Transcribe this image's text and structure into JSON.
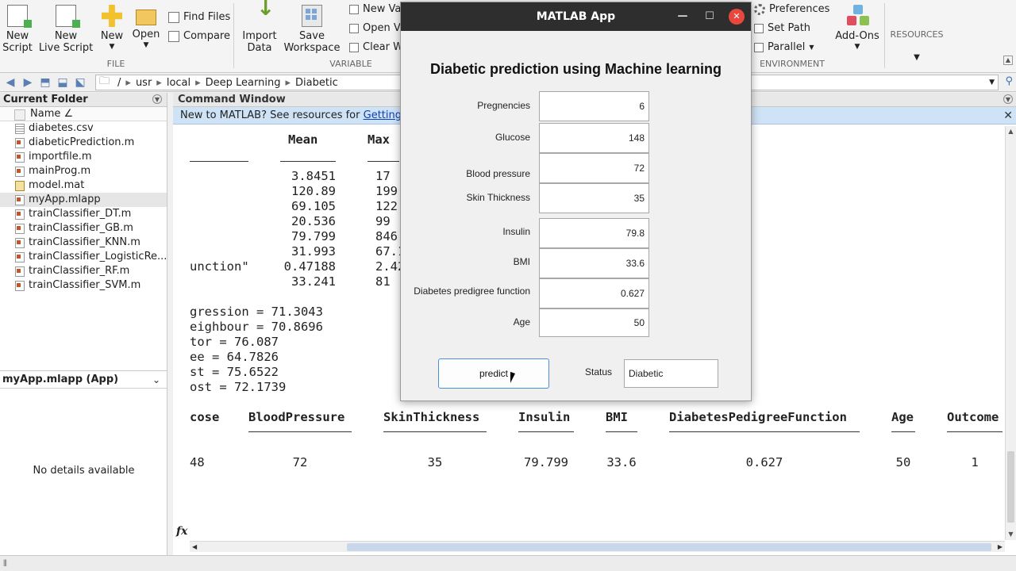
{
  "toolstrip": {
    "file": {
      "new_script": "New\nScript",
      "new_live_script": "New\nLive Script",
      "new": "New",
      "open": "Open",
      "find_files": "Find Files",
      "compare": "Compare",
      "label": "FILE"
    },
    "variable": {
      "import_data": "Import\nData",
      "save_workspace": "Save\nWorkspace",
      "new_variable": "New Va",
      "open_variable": "Open V",
      "clear_workspace": "Clear W",
      "label": "VARIABLE"
    },
    "environment": {
      "preferences": "Preferences",
      "set_path": "Set Path",
      "parallel": "Parallel",
      "add_ons": "Add-Ons",
      "label": "ENVIRONMENT"
    },
    "resources": "RESOURCES"
  },
  "address": {
    "path": [
      "/",
      "usr",
      "local",
      "Deep Learning",
      "Diabetic"
    ]
  },
  "current_folder": {
    "title": "Current Folder",
    "column_name": "Name ∠",
    "files": [
      {
        "name": "diabetes.csv",
        "type": "csv"
      },
      {
        "name": "diabeticPrediction.m",
        "type": "m"
      },
      {
        "name": "importfile.m",
        "type": "m"
      },
      {
        "name": "mainProg.m",
        "type": "m"
      },
      {
        "name": "model.mat",
        "type": "mat"
      },
      {
        "name": "myApp.mlapp",
        "type": "m"
      },
      {
        "name": "trainClassifier_DT.m",
        "type": "m"
      },
      {
        "name": "trainClassifier_GB.m",
        "type": "m"
      },
      {
        "name": "trainClassifier_KNN.m",
        "type": "m"
      },
      {
        "name": "trainClassifier_LogisticRe...",
        "type": "m"
      },
      {
        "name": "trainClassifier_RF.m",
        "type": "m"
      },
      {
        "name": "trainClassifier_SVM.m",
        "type": "m"
      }
    ],
    "selected_index": 5
  },
  "details": {
    "title": "myApp.mlapp  (App)",
    "empty_text": "No details available"
  },
  "command_window": {
    "title": "Command Window",
    "banner_text": "New to MATLAB? See resources for ",
    "banner_link": "Getting S",
    "stats_header": {
      "mean": "Mean",
      "max": "Max"
    },
    "stats_rows": [
      {
        "label": "",
        "mean": "3.8451",
        "max": "17"
      },
      {
        "label": "",
        "mean": "120.89",
        "max": "199"
      },
      {
        "label": "",
        "mean": "69.105",
        "max": "122"
      },
      {
        "label": "",
        "mean": "20.536",
        "max": "99"
      },
      {
        "label": "",
        "mean": "79.799",
        "max": "846"
      },
      {
        "label": "",
        "mean": "31.993",
        "max": "67.1"
      },
      {
        "label": "unction\"",
        "mean": "0.47188",
        "max": "2.42"
      },
      {
        "label": "",
        "mean": "33.241",
        "max": "81"
      }
    ],
    "accuracy_lines": [
      "gression = 71.3043",
      "eighbour = 70.8696",
      "tor = 76.087",
      "ee = 64.7826",
      "st = 75.6522",
      "ost = 72.1739"
    ],
    "table_headers": [
      "cose",
      "BloodPressure",
      "SkinThickness",
      "Insulin",
      "BMI",
      "DiabetesPedigreeFunction",
      "Age",
      "Outcome"
    ],
    "table_values": [
      "48",
      "72",
      "35",
      "79.799",
      "33.6",
      "0.627",
      "50",
      "1"
    ],
    "prompt_symbol": "fx"
  },
  "app": {
    "window_title": "MATLAB App",
    "heading": "Diabetic prediction using Machine learning",
    "fields": [
      {
        "label": "Pregnencies",
        "value": "6"
      },
      {
        "label": "Glucose",
        "value": "148"
      },
      {
        "label": "Blood pressure",
        "value": "72"
      },
      {
        "label": "Skin Thickness",
        "value": "35"
      },
      {
        "label": "Insulin",
        "value": "79.8"
      },
      {
        "label": "BMI",
        "value": "33.6"
      },
      {
        "label": "Diabetes predigree function",
        "value": "0.627"
      },
      {
        "label": "Age",
        "value": "50"
      }
    ],
    "predict_button": "predict",
    "status_label": "Status",
    "status_value": "Diabetic"
  }
}
